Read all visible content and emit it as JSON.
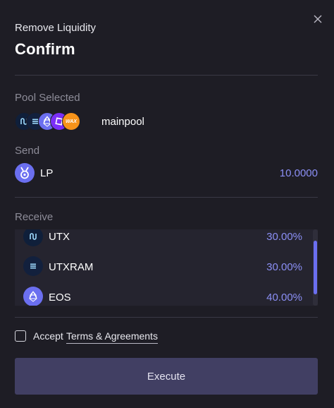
{
  "dialog": {
    "subtitle": "Remove Liquidity",
    "title": "Confirm"
  },
  "pool": {
    "label": "Pool Selected",
    "name": "mainpool",
    "icons": [
      "utx-icon",
      "utxram-icon",
      "eos-icon",
      "purple-token-icon",
      "wax-icon"
    ],
    "wax_text": "WAX"
  },
  "send": {
    "label": "Send",
    "token": "LP",
    "amount": "10.0000",
    "icon": "lp-token-icon"
  },
  "receive": {
    "label": "Receive",
    "items": [
      {
        "token": "UTX",
        "percent": "30.00%",
        "icon": "utx-icon"
      },
      {
        "token": "UTXRAM",
        "percent": "30.00%",
        "icon": "utxram-icon"
      },
      {
        "token": "EOS",
        "percent": "40.00%",
        "icon": "eos-icon"
      }
    ]
  },
  "agreement": {
    "prefix": "Accept",
    "link": "Terms & Agreements",
    "checked": false
  },
  "actions": {
    "execute": "Execute"
  },
  "colors": {
    "background": "#1e1d25",
    "accent": "#8b8ff5",
    "button": "#413f63",
    "muted": "#8d8c98"
  }
}
